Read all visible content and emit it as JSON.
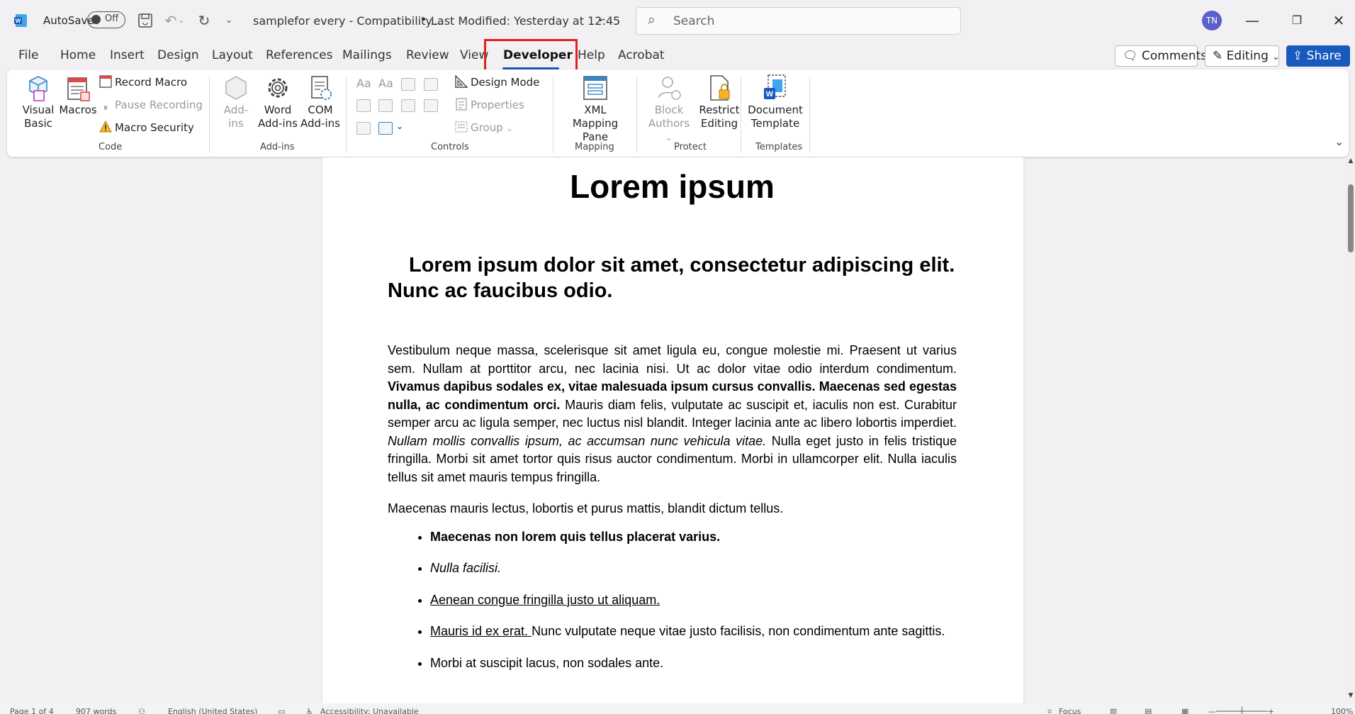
{
  "titlebar": {
    "autosave_label": "AutoSave",
    "autosave_state": "Off",
    "doc_title": "samplefor every  -  Compatibility...",
    "last_modified": "Last Modified: Yesterday at 12:45",
    "search_placeholder": "Search",
    "avatar_initials": "TN"
  },
  "tabs": [
    "File",
    "Home",
    "Insert",
    "Design",
    "Layout",
    "References",
    "Mailings",
    "Review",
    "View",
    "Developer",
    "Help",
    "Acrobat"
  ],
  "active_tab": "Developer",
  "right_buttons": {
    "comments": "Comments",
    "editing": "Editing",
    "share": "Share"
  },
  "ribbon": {
    "code": {
      "label": "Code",
      "visual_basic": "Visual Basic",
      "macros": "Macros",
      "record_macro": "Record Macro",
      "pause_recording": "Pause Recording",
      "macro_security": "Macro Security"
    },
    "addins": {
      "label": "Add-ins",
      "add_ins": "Add-ins",
      "word_add_ins": "Word Add-ins",
      "com_add_ins": "COM Add-ins"
    },
    "controls": {
      "label": "Controls",
      "design_mode": "Design Mode",
      "properties": "Properties",
      "group": "Group"
    },
    "mapping": {
      "label": "Mapping",
      "xml_mapping_pane": "XML Mapping Pane"
    },
    "protect": {
      "label": "Protect",
      "block_authors": "Block Authors",
      "restrict_editing": "Restrict Editing"
    },
    "templates": {
      "label": "Templates",
      "document_template": "Document Template"
    }
  },
  "document": {
    "title": "Lorem ipsum",
    "subtitle": "Lorem ipsum dolor sit amet, consectetur adipiscing elit. Nunc ac faucibus odio.",
    "p1_a": "Vestibulum neque massa, scelerisque sit amet ligula eu, congue molestie mi. Praesent ut varius sem. Nullam at porttitor arcu, nec lacinia nisi. Ut ac dolor vitae odio interdum condimentum. ",
    "p1_b": "Vivamus dapibus sodales ex, vitae malesuada ipsum cursus convallis. Maecenas sed egestas nulla, ac condimentum orci.",
    "p1_c": " Mauris diam felis, vulputate ac suscipit et, iaculis non est. Curabitur semper arcu ac ligula semper, nec luctus nisl blandit. Integer lacinia ante ac libero lobortis imperdiet. ",
    "p1_d": "Nullam mollis convallis ipsum, ac accumsan nunc vehicula vitae.",
    "p1_e": " Nulla eget justo in felis tristique fringilla. Morbi sit amet tortor quis risus auctor condimentum. Morbi in ullamcorper elit. Nulla iaculis tellus sit amet mauris tempus fringilla.",
    "p2": "Maecenas mauris lectus, lobortis et purus mattis, blandit dictum tellus.",
    "bullet1": "Maecenas non lorem quis tellus placerat varius.",
    "bullet2": "Nulla facilisi.",
    "bullet3": "Aenean congue fringilla justo ut aliquam. ",
    "bullet4_a": "Mauris id ex erat. ",
    "bullet4_b": "Nunc vulputate neque vitae justo facilisis, non condimentum ante sagittis.",
    "bullet5": "Morbi at suscipit lacus, non sodales ante."
  },
  "statusbar": {
    "page": "Page 1 of 4",
    "words": "907 words",
    "language": "English (United States)",
    "accessibility": "Accessibility: Unavailable",
    "focus": "Focus",
    "zoom": "100%"
  },
  "colors": {
    "accent": "#185abd",
    "highlight": "#e02020",
    "avatar": "#5b5fc7"
  }
}
